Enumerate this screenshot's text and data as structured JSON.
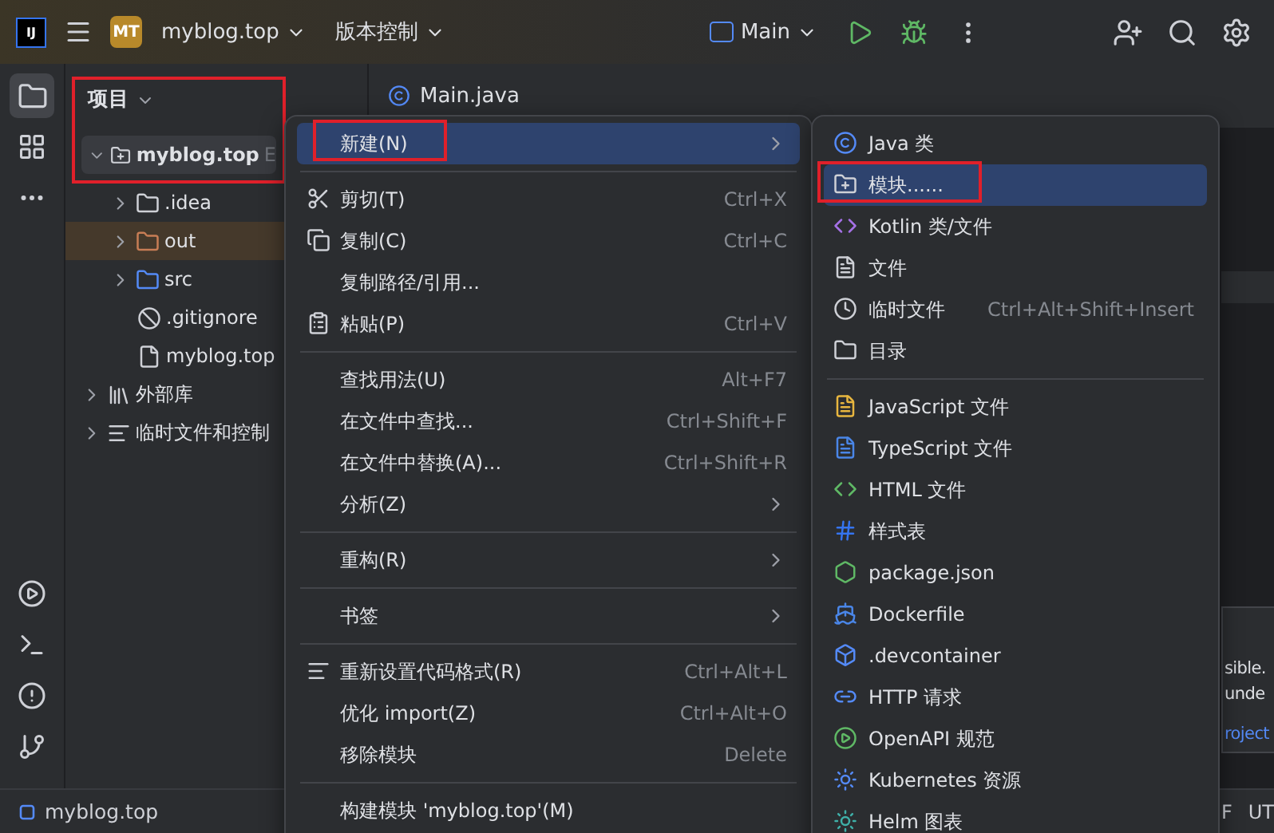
{
  "toolbar": {
    "logo": "IJ",
    "project_badge": "MT",
    "project_name": "myblog.top",
    "vcs": "版本控制",
    "run_config": "Main"
  },
  "project": {
    "title": "项目",
    "marked": true,
    "root": {
      "name": "myblog.top",
      "suffix": "E",
      "expanded": true,
      "children": [
        {
          "name": ".idea",
          "kind": "folder",
          "expanded": false,
          "selected": false
        },
        {
          "name": "out",
          "kind": "excluded",
          "expanded": false,
          "selected": true
        },
        {
          "name": "src",
          "kind": "source",
          "expanded": false,
          "selected": false
        },
        {
          "name": ".gitignore",
          "kind": "ignore",
          "selected": false
        },
        {
          "name": "myblog.top",
          "kind": "module-file",
          "selected": false
        }
      ]
    },
    "extra": [
      {
        "name": "外部库",
        "kind": "library",
        "expanded": false
      },
      {
        "name": "临时文件和控制",
        "kind": "scratch",
        "expanded": false
      }
    ]
  },
  "editor": {
    "tab": "Main.java"
  },
  "menu": [
    {
      "kind": "item",
      "label": "新建(N)",
      "submenu": true,
      "selected": true,
      "marked": true
    },
    {
      "kind": "separator"
    },
    {
      "kind": "item",
      "label": "剪切(T)",
      "shortcut": "Ctrl+X",
      "selected": false
    },
    {
      "kind": "item",
      "label": "复制(C)",
      "shortcut": "Ctrl+C",
      "selected": false
    },
    {
      "kind": "item",
      "label": "复制路径/引用...",
      "selected": false
    },
    {
      "kind": "item",
      "label": "粘贴(P)",
      "shortcut": "Ctrl+V",
      "selected": false
    },
    {
      "kind": "separator"
    },
    {
      "kind": "item",
      "label": "查找用法(U)",
      "shortcut": "Alt+F7",
      "selected": false
    },
    {
      "kind": "item",
      "label": "在文件中查找...",
      "shortcut": "Ctrl+Shift+F",
      "selected": false
    },
    {
      "kind": "item",
      "label": "在文件中替换(A)...",
      "shortcut": "Ctrl+Shift+R",
      "selected": false
    },
    {
      "kind": "item",
      "label": "分析(Z)",
      "submenu": true,
      "selected": false
    },
    {
      "kind": "separator"
    },
    {
      "kind": "item",
      "label": "重构(R)",
      "submenu": true,
      "selected": false
    },
    {
      "kind": "separator"
    },
    {
      "kind": "item",
      "label": "书签",
      "submenu": true,
      "selected": false
    },
    {
      "kind": "separator"
    },
    {
      "kind": "item",
      "label": "重新设置代码格式(R)",
      "shortcut": "Ctrl+Alt+L",
      "selected": false
    },
    {
      "kind": "item",
      "label": "优化 import(Z)",
      "shortcut": "Ctrl+Alt+O",
      "selected": false
    },
    {
      "kind": "item",
      "label": "移除模块",
      "shortcut": "Delete",
      "selected": false
    },
    {
      "kind": "separator"
    },
    {
      "kind": "item",
      "label": "构建模块 'myblog.top'(M)",
      "selected": false
    }
  ],
  "submenu": [
    {
      "kind": "item",
      "label": "Java 类",
      "selected": false
    },
    {
      "kind": "item",
      "label": "模块......",
      "selected": true,
      "marked": true
    },
    {
      "kind": "item",
      "label": "Kotlin 类/文件",
      "selected": false
    },
    {
      "kind": "item",
      "label": "文件",
      "selected": false
    },
    {
      "kind": "item",
      "label": "临时文件",
      "shortcut": "Ctrl+Alt+Shift+Insert",
      "selected": false
    },
    {
      "kind": "item",
      "label": "目录",
      "selected": false
    },
    {
      "kind": "separator"
    },
    {
      "kind": "item",
      "label": "JavaScript 文件",
      "selected": false
    },
    {
      "kind": "item",
      "label": "TypeScript 文件",
      "selected": false
    },
    {
      "kind": "item",
      "label": "HTML 文件",
      "selected": false
    },
    {
      "kind": "item",
      "label": "样式表",
      "selected": false
    },
    {
      "kind": "item",
      "label": "package.json",
      "selected": false
    },
    {
      "kind": "item",
      "label": "Dockerfile",
      "selected": false
    },
    {
      "kind": "item",
      "label": ".devcontainer",
      "selected": false
    },
    {
      "kind": "item",
      "label": "HTTP 请求",
      "selected": false
    },
    {
      "kind": "item",
      "label": "OpenAPI 规范",
      "selected": false
    },
    {
      "kind": "item",
      "label": "Kubernetes 资源",
      "selected": false
    },
    {
      "kind": "item",
      "label": "Helm 图表",
      "selected": false
    }
  ],
  "notification": {
    "lines": [
      "sible.",
      "unde"
    ],
    "link": "roject"
  },
  "status_bar": {
    "module": "myblog.top",
    "right": [
      "F",
      "UT"
    ]
  }
}
